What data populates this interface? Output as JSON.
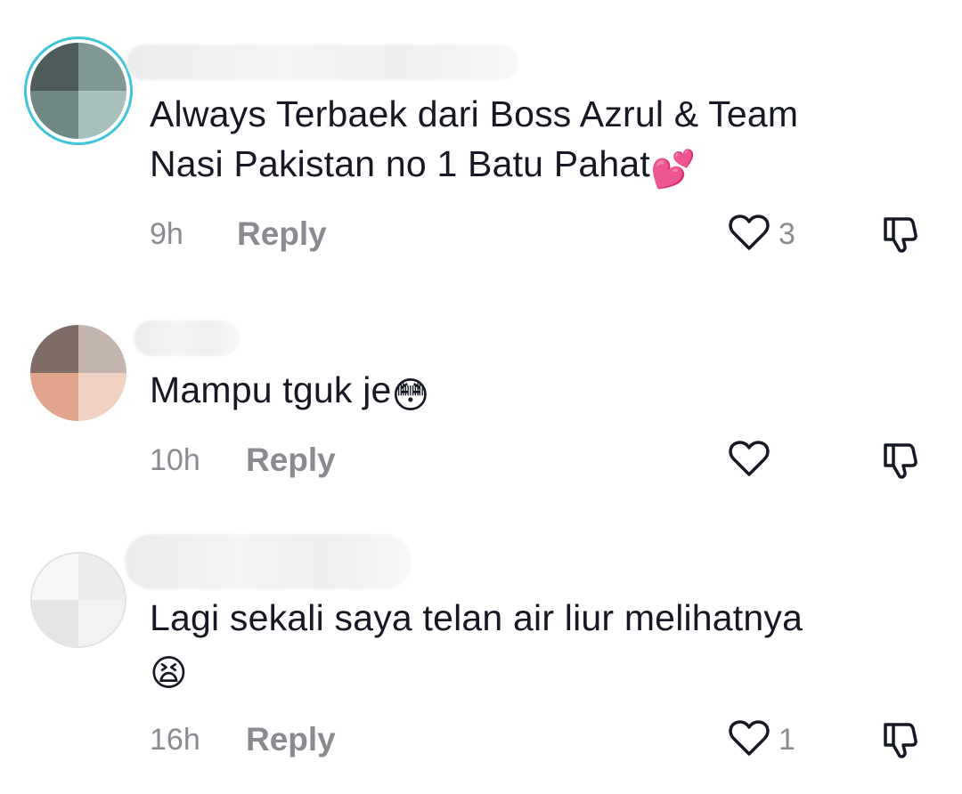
{
  "comments": [
    {
      "text_line1": "Always Terbaek dari Boss Azrul & Team",
      "text_line2": "Nasi Pakistan no 1 Batu Pahat",
      "emoji": "💕",
      "time": "9h",
      "reply_label": "Reply",
      "likes": "3"
    },
    {
      "text_line1": "Mampu tguk je",
      "emoji": "😳",
      "time": "10h",
      "reply_label": "Reply",
      "likes": ""
    },
    {
      "text_line1": "Lagi sekali saya telan air liur melihatnya",
      "emoji": "😫",
      "time": "16h",
      "reply_label": "Reply",
      "likes": "1"
    }
  ],
  "icons": {
    "like": "heart-outline-icon",
    "dislike": "thumbs-down-outline-icon"
  },
  "colors": {
    "text": "#161823",
    "muted": "#8a8b91",
    "avatar_ring": "#3fc4d8"
  }
}
